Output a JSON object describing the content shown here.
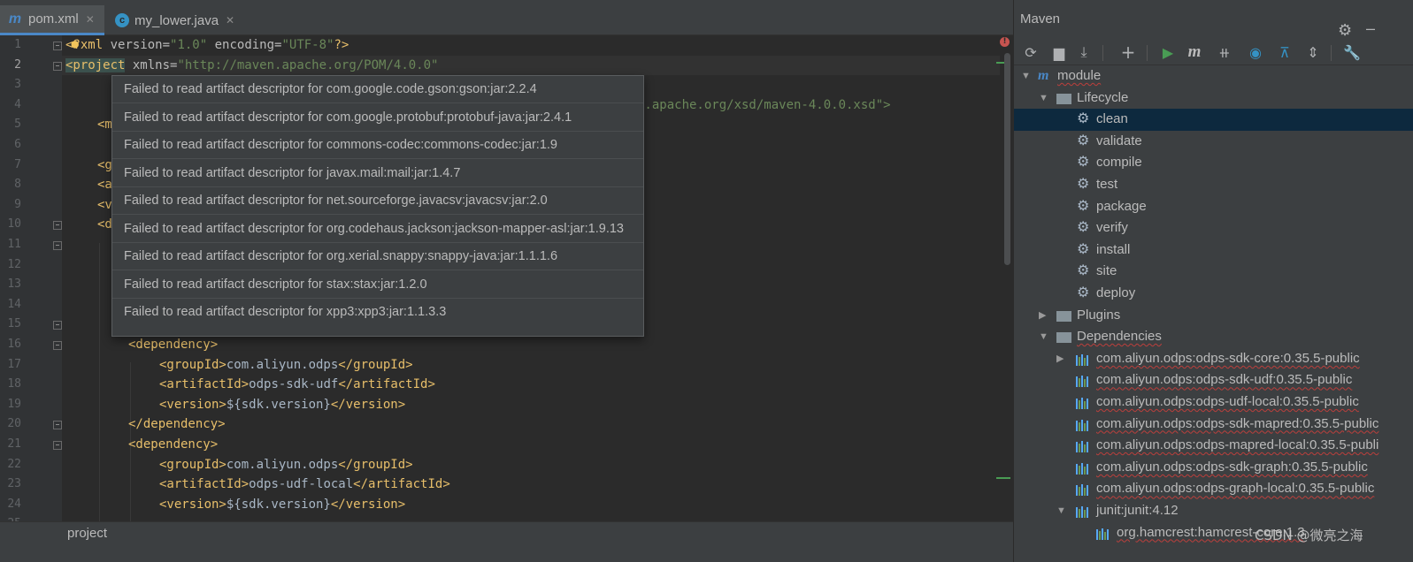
{
  "tabs": [
    {
      "icon": "maven-m-icon",
      "label": "pom.xml",
      "active": true
    },
    {
      "icon": "java-class-icon",
      "label": "my_lower.java",
      "active": false
    }
  ],
  "editor": {
    "line_numbers": [
      "1",
      "2",
      "3",
      "4",
      "5",
      "6",
      "7",
      "8",
      "9",
      "10",
      "11",
      "12",
      "13",
      "14",
      "15",
      "16",
      "17",
      "18",
      "19",
      "20",
      "21",
      "22",
      "23",
      "24",
      "25"
    ],
    "current_line": "2",
    "lines": {
      "l1": {
        "open": "<",
        "tag": "?xml",
        "a1": " version=",
        "v1": "\"1.0\"",
        "a2": " encoding=",
        "v2": "\"UTF-8\"",
        "close": "?>"
      },
      "l2": {
        "tag": "<project",
        "a1": " xmlns=",
        "v1": "\"http://maven.apache.org/POM/4.0.0\""
      },
      "l4_tail": "n.apache.org/xsd/maven-4.0.0.xsd\">",
      "l5": "<m",
      "l7": "<g",
      "l8": "<a",
      "l9": "<v",
      "l10": "<d",
      "l16": "<dependency>",
      "l17": {
        "o": "<groupId>",
        "t": "com.aliyun.odps",
        "c": "</groupId>"
      },
      "l18": {
        "o": "<artifactId>",
        "t": "odps-sdk-udf",
        "c": "</artifactId>"
      },
      "l19": {
        "o": "<version>",
        "t": "${sdk.version}",
        "c": "</version>"
      },
      "l20": "</dependency>",
      "l21": "<dependency>",
      "l22": {
        "o": "<groupId>",
        "t": "com.aliyun.odps",
        "c": "</groupId>"
      },
      "l23": {
        "o": "<artifactId>",
        "t": "odps-udf-local",
        "c": "</artifactId>"
      },
      "l24": {
        "o": "<version>",
        "t": "${sdk.version}",
        "c": "</version>"
      }
    }
  },
  "popup": {
    "items": [
      "Failed to read artifact descriptor for com.google.code.gson:gson:jar:2.2.4",
      "Failed to read artifact descriptor for com.google.protobuf:protobuf-java:jar:2.4.1",
      "Failed to read artifact descriptor for commons-codec:commons-codec:jar:1.9",
      "Failed to read artifact descriptor for javax.mail:mail:jar:1.4.7",
      "Failed to read artifact descriptor for net.sourceforge.javacsv:javacsv:jar:2.0",
      "Failed to read artifact descriptor for org.codehaus.jackson:jackson-mapper-asl:jar:1.9.13",
      "Failed to read artifact descriptor for org.xerial.snappy:snappy-java:jar:1.1.1.6",
      "Failed to read artifact descriptor for stax:stax:jar:1.2.0",
      "Failed to read artifact descriptor for xpp3:xpp3:jar:1.1.3.3"
    ]
  },
  "breadcrumb": "project",
  "maven": {
    "title": "Maven",
    "toolbar_icons": [
      "reload-icon",
      "add-folder-icon",
      "download-icon",
      "plus-icon",
      "run-icon",
      "maven-goal-icon",
      "toggle-offline-icon",
      "skip-tests-icon",
      "show-dependencies-icon",
      "collapse-all-icon",
      "settings-wrench-icon"
    ],
    "tree": {
      "root": "module",
      "lifecycle": "Lifecycle",
      "phases": [
        "clean",
        "validate",
        "compile",
        "test",
        "package",
        "verify",
        "install",
        "site",
        "deploy"
      ],
      "selected_phase": "clean",
      "plugins": "Plugins",
      "dependencies": "Dependencies",
      "deps": [
        "com.aliyun.odps:odps-sdk-core:0.35.5-public",
        "com.aliyun.odps:odps-sdk-udf:0.35.5-public",
        "com.aliyun.odps:odps-udf-local:0.35.5-public",
        "com.aliyun.odps:odps-sdk-mapred:0.35.5-public",
        "com.aliyun.odps:odps-mapred-local:0.35.5-publi",
        "com.aliyun.odps:odps-sdk-graph:0.35.5-public",
        "com.aliyun.odps:odps-graph-local:0.35.5-public",
        "junit:junit:4.12"
      ],
      "sub_dep": "org.hamcrest:hamcrest-core:1.3"
    }
  },
  "watermark": "CSDN @微亮之海",
  "colors": {
    "tag": "#e8bf6a",
    "string": "#6a8759",
    "selection": "#0d293e",
    "error_underline": "#bc3f3c"
  }
}
